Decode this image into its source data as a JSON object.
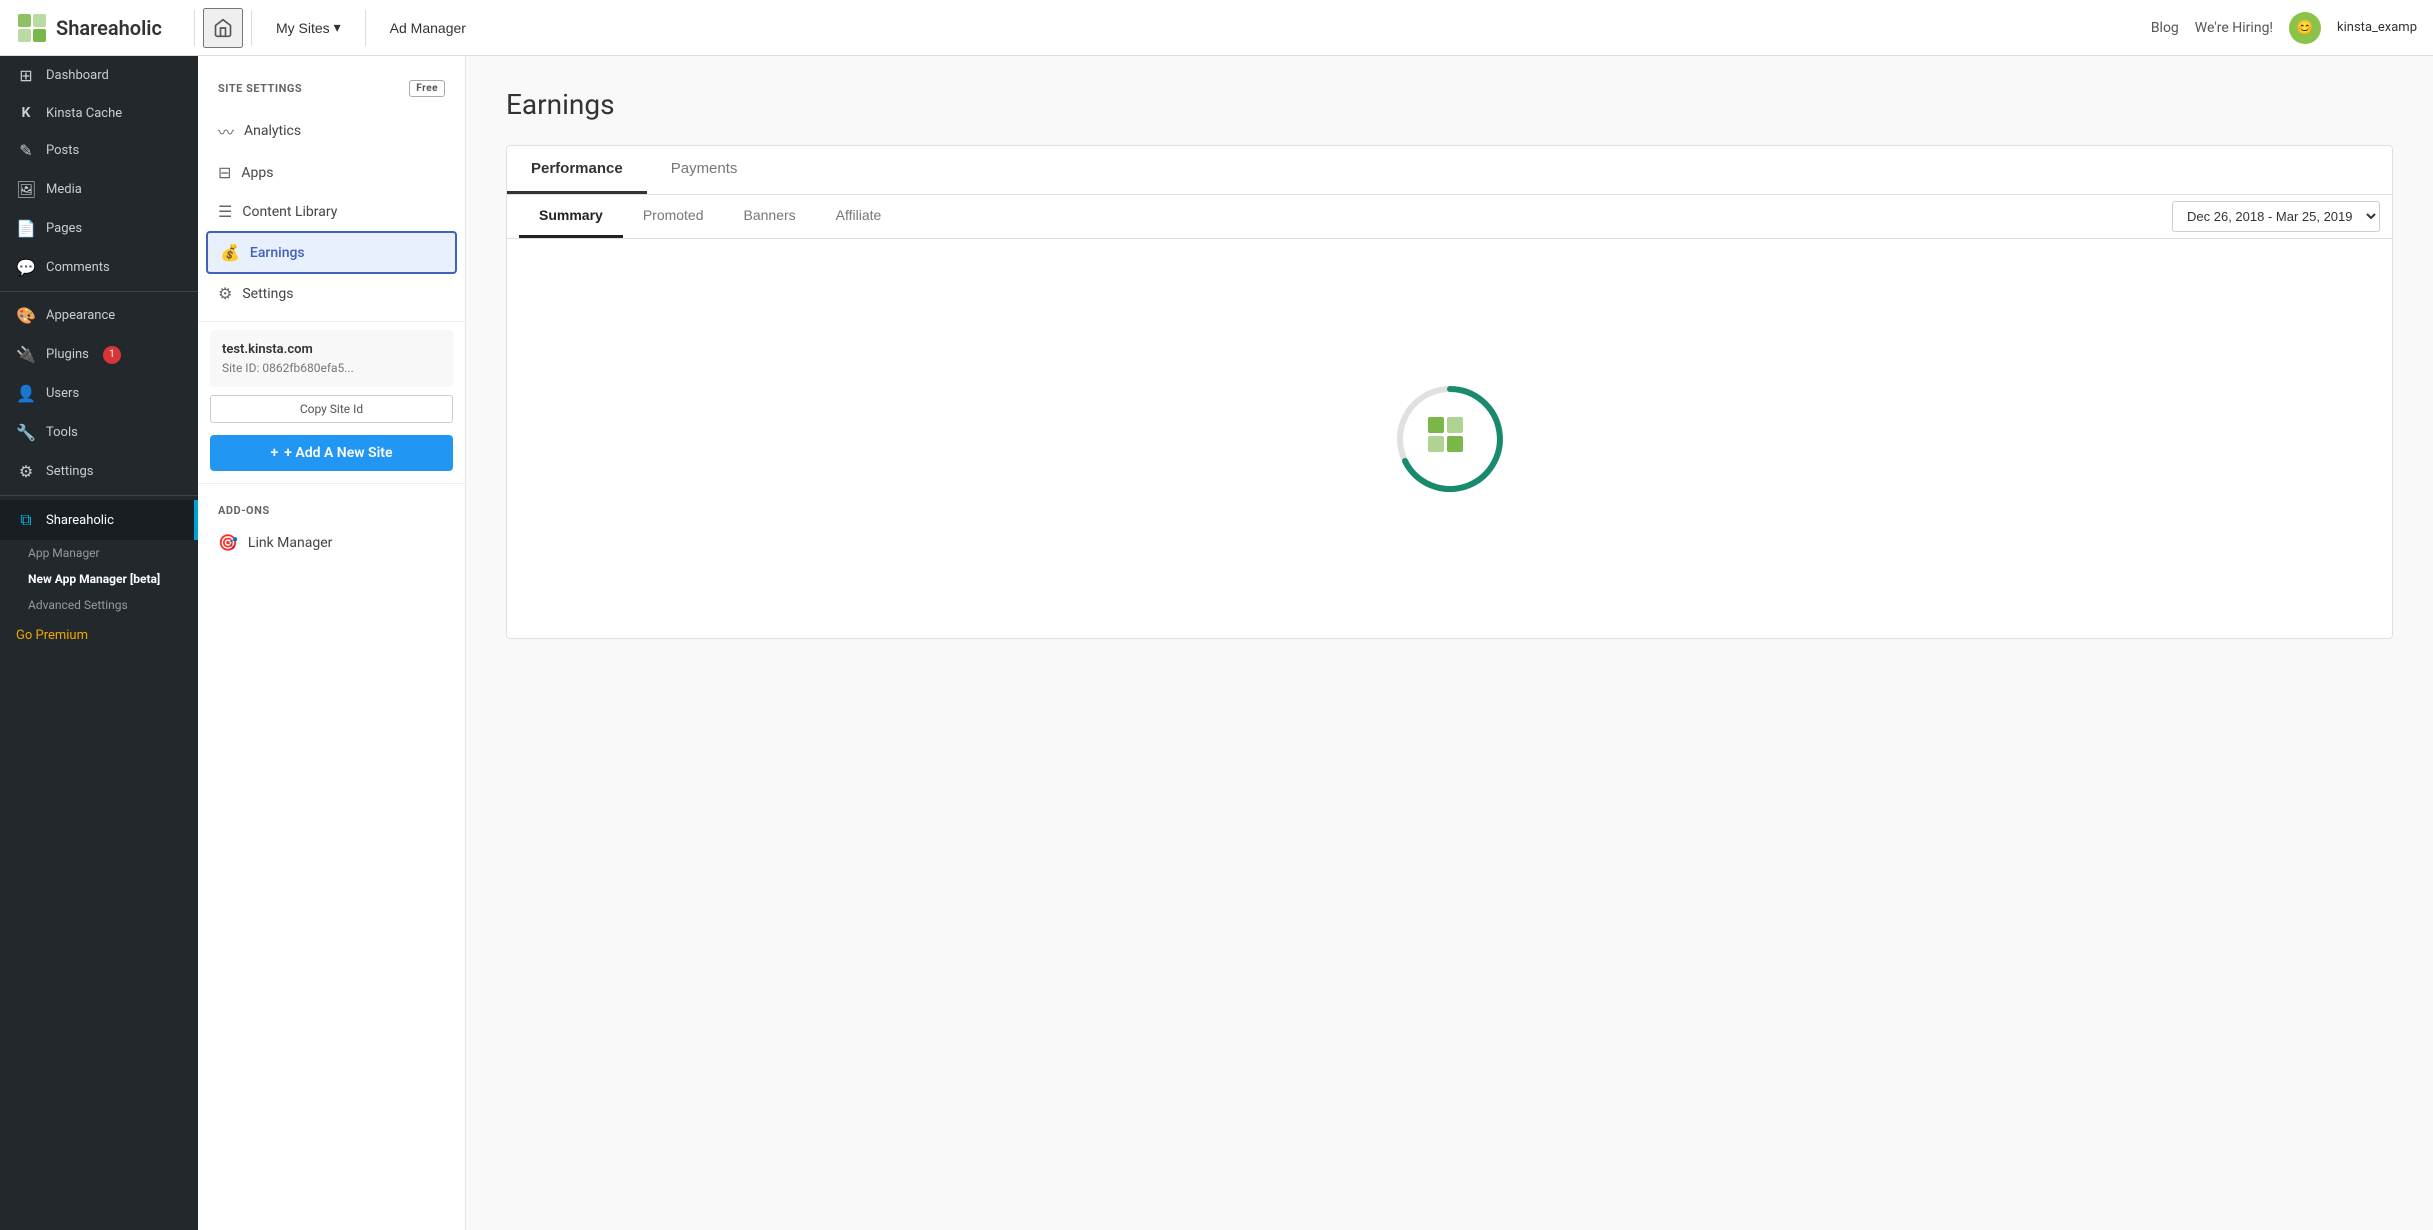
{
  "topnav": {
    "logo_text": "Shareaholic",
    "home_icon": "🏠",
    "my_sites_label": "My Sites",
    "ad_manager_label": "Ad Manager",
    "blog_label": "Blog",
    "hiring_label": "We're Hiring!",
    "user_name": "kinsta_examp"
  },
  "wp_sidebar": {
    "items": [
      {
        "id": "dashboard",
        "icon": "⊞",
        "label": "Dashboard"
      },
      {
        "id": "kinsta-cache",
        "icon": "K",
        "label": "Kinsta Cache"
      },
      {
        "id": "posts",
        "icon": "✎",
        "label": "Posts"
      },
      {
        "id": "media",
        "icon": "🖼",
        "label": "Media"
      },
      {
        "id": "pages",
        "icon": "📄",
        "label": "Pages"
      },
      {
        "id": "comments",
        "icon": "💬",
        "label": "Comments"
      },
      {
        "id": "appearance",
        "icon": "🎨",
        "label": "Appearance"
      },
      {
        "id": "plugins",
        "icon": "🔌",
        "label": "Plugins",
        "badge": "1"
      },
      {
        "id": "users",
        "icon": "👤",
        "label": "Users"
      },
      {
        "id": "tools",
        "icon": "🔧",
        "label": "Tools"
      },
      {
        "id": "settings",
        "icon": "⚙",
        "label": "Settings"
      },
      {
        "id": "shareaholic",
        "icon": "⧉",
        "label": "Shareaholic",
        "active": true
      }
    ],
    "sub_items": [
      {
        "id": "app-manager",
        "label": "App Manager"
      },
      {
        "id": "new-app-manager",
        "label": "New App Manager [beta]",
        "bold": true
      },
      {
        "id": "advanced-settings",
        "label": "Advanced Settings"
      }
    ],
    "go_premium": "Go Premium"
  },
  "shareaholic_sidebar": {
    "section_header": "SITE SETTINGS",
    "free_badge": "Free",
    "menu_items": [
      {
        "id": "analytics",
        "icon": "📈",
        "label": "Analytics"
      },
      {
        "id": "apps",
        "icon": "📦",
        "label": "Apps"
      },
      {
        "id": "content-library",
        "icon": "☰",
        "label": "Content Library"
      },
      {
        "id": "earnings",
        "icon": "💰",
        "label": "Earnings",
        "active": true
      },
      {
        "id": "settings",
        "icon": "⚙",
        "label": "Settings"
      }
    ],
    "site_name": "test.kinsta.com",
    "site_id_label": "Site ID:",
    "site_id_value": "0862fb680efa5...",
    "copy_site_btn": "Copy Site Id",
    "add_site_btn": "+ Add A New Site",
    "addons_header": "ADD-ONS",
    "addon_items": [
      {
        "id": "link-manager",
        "icon": "🎯",
        "label": "Link Manager"
      }
    ]
  },
  "main": {
    "page_title": "Earnings",
    "tabs": [
      {
        "id": "performance",
        "label": "Performance",
        "active": true
      },
      {
        "id": "payments",
        "label": "Payments"
      }
    ],
    "sub_tabs": [
      {
        "id": "summary",
        "label": "Summary",
        "active": true
      },
      {
        "id": "promoted",
        "label": "Promoted"
      },
      {
        "id": "banners",
        "label": "Banners"
      },
      {
        "id": "affiliate",
        "label": "Affiliate"
      }
    ],
    "date_range": "Dec 26, 2018  -  Mar 25, 2019"
  }
}
